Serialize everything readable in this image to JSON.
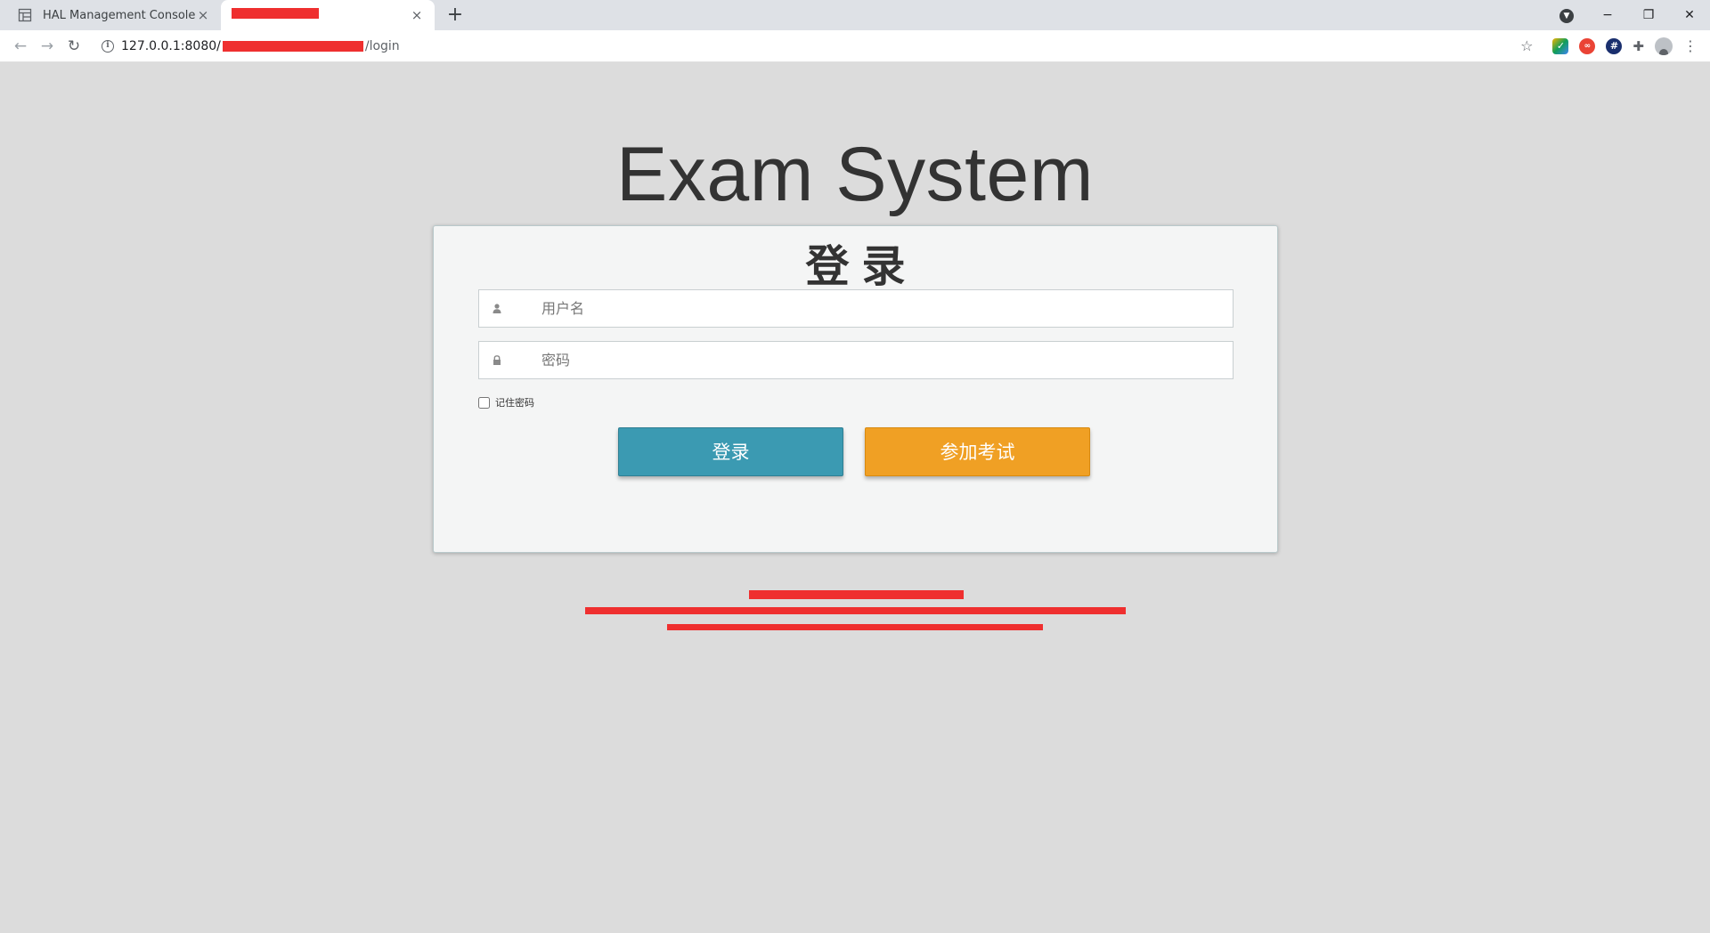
{
  "browser": {
    "tabs": [
      {
        "title": "HAL Management Console",
        "active": false,
        "close": "×"
      },
      {
        "title": "",
        "active": true,
        "close": "×",
        "redacted": true
      }
    ],
    "new_tab": "+",
    "window_controls": {
      "minimize": "−",
      "restore": "❐",
      "close": "✕"
    },
    "url": {
      "prefix": "127.0.0.1:8080/",
      "suffix": "/login"
    },
    "nav": {
      "back": "←",
      "forward": "→",
      "reload": "↻"
    },
    "icons": [
      "info-icon",
      "star-icon",
      "extension-icon",
      "puzzle-icon",
      "profile-icon",
      "menu-icon"
    ]
  },
  "page": {
    "app_title": "Exam System",
    "card": {
      "heading": "登录",
      "username_placeholder": "用户名",
      "password_placeholder": "密码",
      "remember_label": "记住密码",
      "login_button": "登录",
      "exam_button": "参加考试"
    },
    "colors": {
      "login_button": "#3b9ab2",
      "exam_button": "#f0a024",
      "redaction": "#ef2f2f",
      "background": "#dcdcdc"
    }
  }
}
